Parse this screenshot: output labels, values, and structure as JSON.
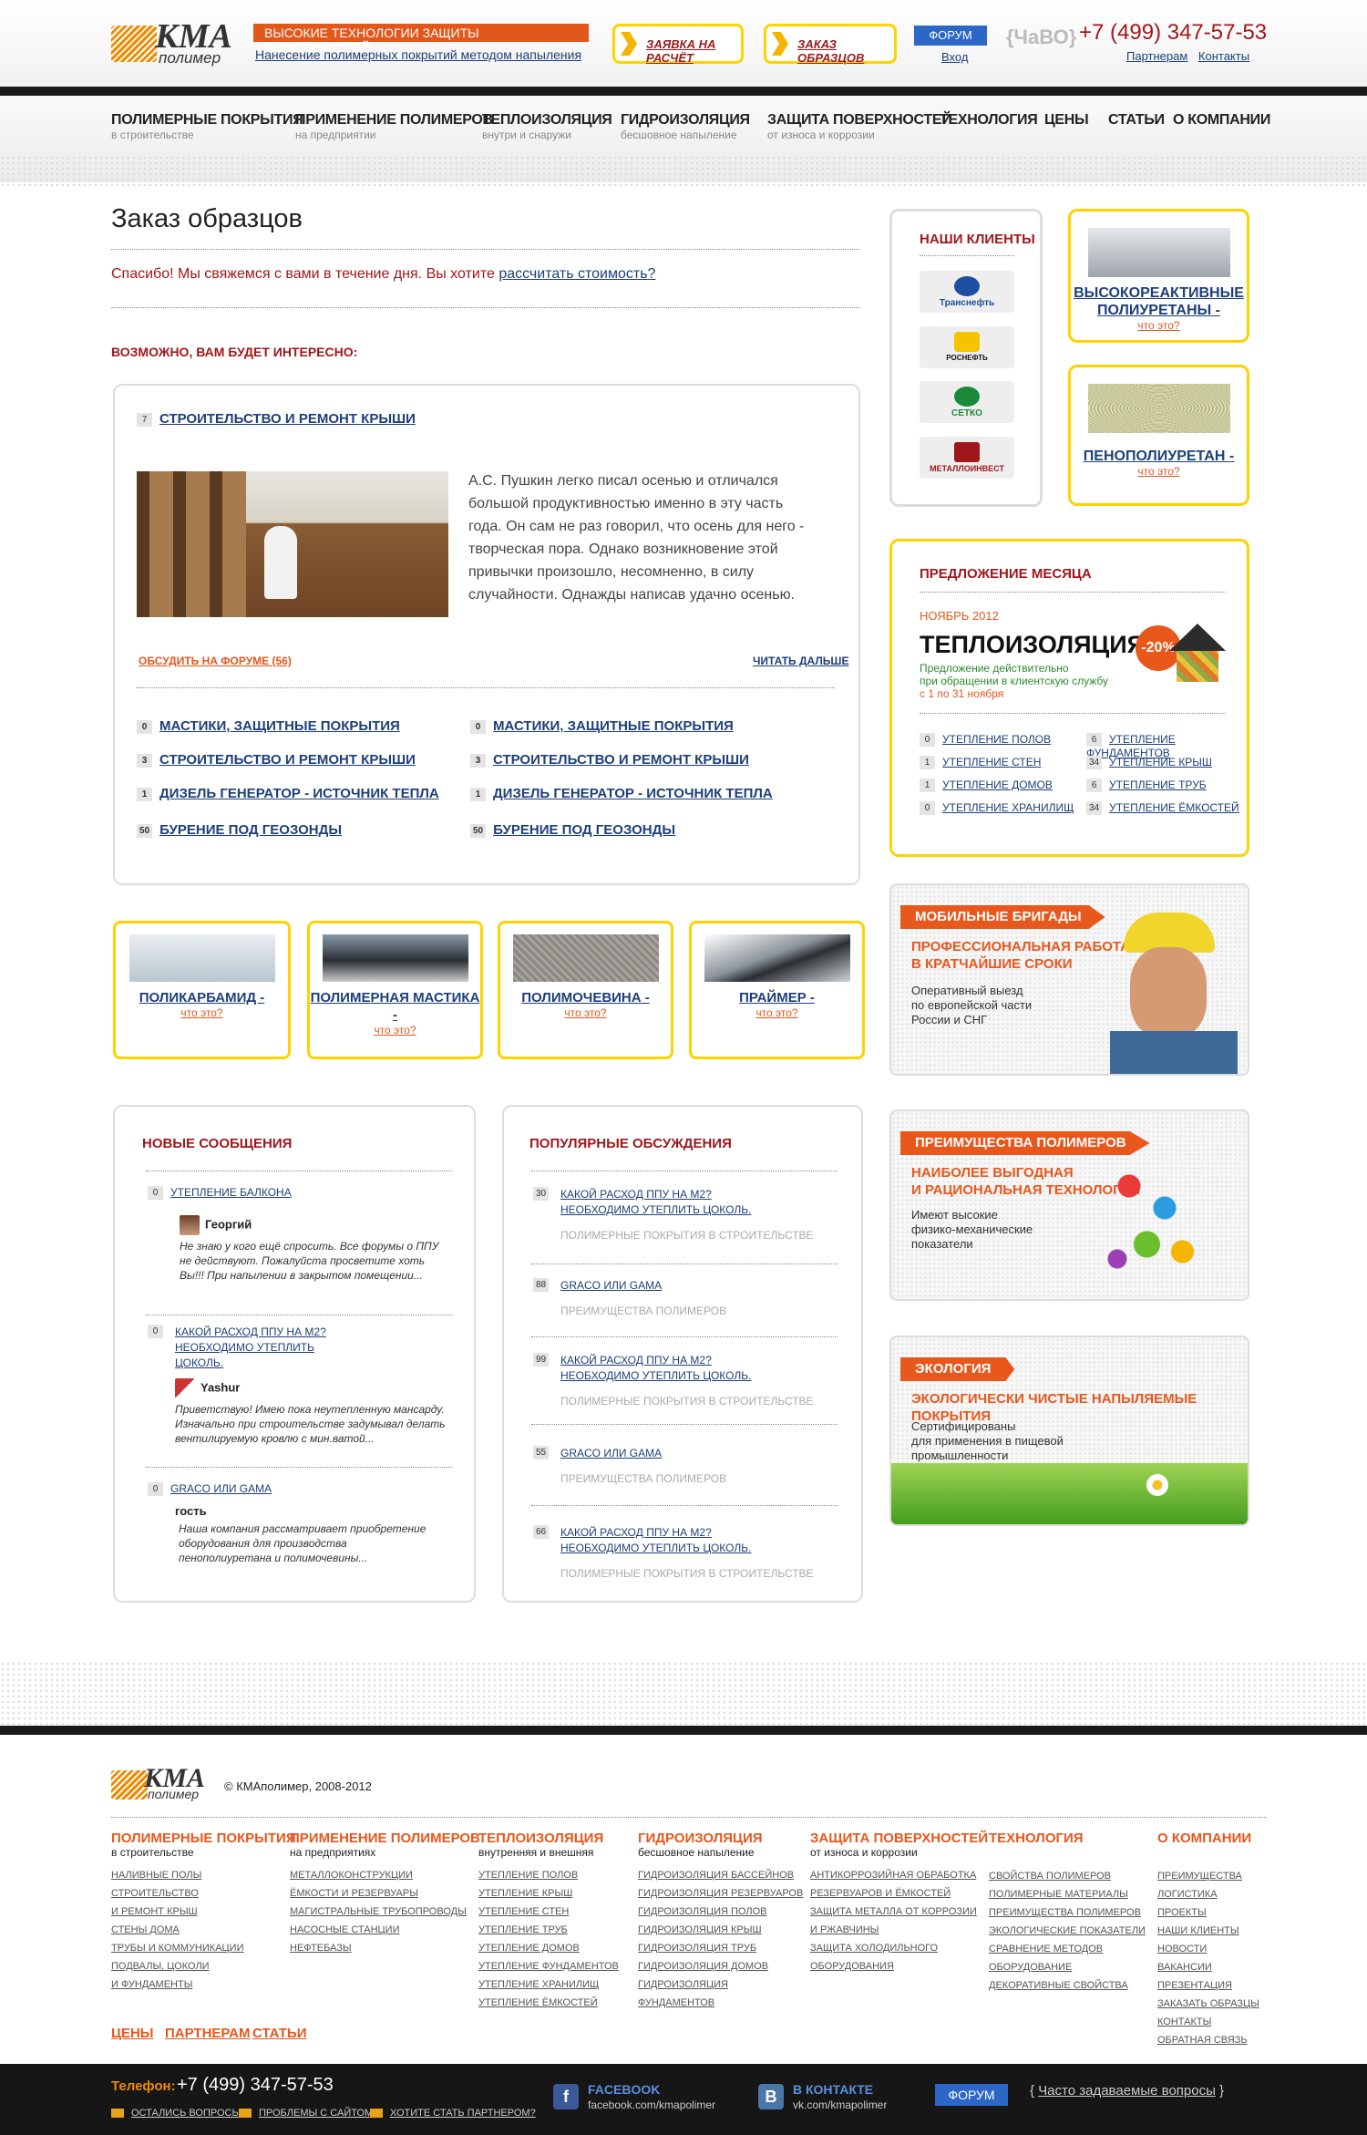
{
  "header": {
    "logo_main": "КМА",
    "logo_sub": "полимер",
    "tagline": "ВЫСОКИЕ ТЕХНОЛОГИИ ЗАЩИТЫ ПОВЕРХНОСТЕЙ",
    "tagline_link": "Нанесение полимерных покрытий методом напыления",
    "btn_request": "Заявка на расчёт",
    "btn_samples": "Заказ образцов",
    "forum": "ФОРУМ",
    "login": "Вход",
    "faq_logo": "{ЧаВО}",
    "phone": "+7 (499) 347-57-53",
    "partners": "Партнерам",
    "contacts": "Контакты"
  },
  "nav": [
    {
      "main": "Полимерные покрытия",
      "sub": "в строительстве"
    },
    {
      "main": "Применение полимеров",
      "sub": "на предприятии"
    },
    {
      "main": "Теплоизоляция",
      "sub": "внутри и снаружи"
    },
    {
      "main": "Гидроизоляция",
      "sub": "бесшовное напыление"
    },
    {
      "main": "Защита поверхностей",
      "sub": "от износа и коррозии"
    },
    {
      "main": "Технология",
      "sub": ""
    },
    {
      "main": "Цены",
      "sub": ""
    },
    {
      "main": "Статьи",
      "sub": ""
    },
    {
      "main": "О компании",
      "sub": ""
    }
  ],
  "content": {
    "title": "Заказ образцов",
    "thanks": "Спасибо! Мы свяжемся с вами в течение дня. Вы хотите",
    "thanks_link": "рассчитать стоимость?",
    "maybe": "Возможно, вам будет интересно:",
    "article": {
      "count": "7",
      "title": "Строительство и ремонт крыши",
      "text": "А.С. Пушкин легко писал осенью и отличался большой продуктивностью именно в эту часть года. Он сам не раз говорил, что осень для него - творческая пора. Однако возникновение этой привычки произошло, несомненно, в силу случайности. Однажды написав удачно осенью.",
      "discuss": "Обсудить на форуме (56)",
      "read_more": "Читать дальше"
    },
    "links_left": [
      {
        "n": "0",
        "t": "Мастики, защитные покрытия"
      },
      {
        "n": "3",
        "t": "Строительство и ремонт крыши"
      },
      {
        "n": "1",
        "t": "Дизель генератор - источник тепла"
      },
      {
        "n": "50",
        "t": "Бурение под геозонды"
      }
    ],
    "links_right": [
      {
        "n": "0",
        "t": "Мастики, защитные покрытия"
      },
      {
        "n": "3",
        "t": "Строительство и ремонт крыши"
      },
      {
        "n": "1",
        "t": "Дизель генератор - источник тепла"
      },
      {
        "n": "50",
        "t": "Бурение под геозонды"
      }
    ],
    "products": [
      {
        "name": "Поликарбамид -",
        "q": "что это?"
      },
      {
        "name": "Полимерная мастика -",
        "q": "что это?"
      },
      {
        "name": "Полимочевина -",
        "q": "что это?"
      },
      {
        "name": "Праймер -",
        "q": "что это?"
      }
    ]
  },
  "new_messages": {
    "title": "Новые сообщения",
    "items": [
      {
        "n": "0",
        "t": "Утепление балкона",
        "author": "Георгий",
        "msg": "Не знаю у кого ещё спросить. Все форумы о ППУ не действуют. Пожалуйста просветите хоть Вы!!! При напылении в закрытом помещении..."
      },
      {
        "n": "0",
        "t": "Какой расход ППУ на м2? Необходимо утеплить цоколь.",
        "author": "Yashur",
        "msg": "Приветствую! Имею пока неутепленную мансарду. Изначально при строительстве задумывал делать вентилируемую кровлю с мин.ватой..."
      },
      {
        "n": "0",
        "t": "GRACO или GAMA",
        "author": "гость",
        "msg": "Наша компания рассматривает приобретение оборудования для производства пенополиуретана и полимочевины..."
      }
    ]
  },
  "popular": {
    "title": "Популярные обсуждения",
    "items": [
      {
        "n": "30",
        "t": "Какой расход ППУ на м2? Необходимо утеплить цоколь.",
        "cat": "Полимерные покрытия в строительстве"
      },
      {
        "n": "88",
        "t": "GRACO или GAMA",
        "cat": "Преимущества полимеров"
      },
      {
        "n": "99",
        "t": "Какой расход ППУ на м2? Необходимо утеплить цоколь.",
        "cat": "Полимерные покрытия в строительстве"
      },
      {
        "n": "55",
        "t": "GRACO или GAMA",
        "cat": "Преимущества полимеров"
      },
      {
        "n": "66",
        "t": "Какой расход ППУ на м2? Необходимо утеплить цоколь.",
        "cat": "Полимерные покрытия в строительстве"
      }
    ]
  },
  "sidebar": {
    "clients_title": "Наши клиенты",
    "clients": [
      "Транснефть",
      "РОСНЕФТЬ",
      "СЕТКО",
      "МЕТАЛЛОИНВЕСТ"
    ],
    "box1": {
      "name": "Высокореактивные полиуретаны -",
      "q": "что это?"
    },
    "box2": {
      "name": "Пенополиуретан -",
      "q": "что это?"
    },
    "offer": {
      "title": "Предложение месяца",
      "month": "Ноябрь 2012",
      "big": "Теплоизоляция",
      "discount": "-20%",
      "desc1": "Предложение действительно",
      "desc2": "при обращении в клиентскую службу",
      "desc3": "с 1 по 31 ноября",
      "rows_left": [
        {
          "n": "0",
          "t": "Утепление полов"
        },
        {
          "n": "1",
          "t": "Утепление стен"
        },
        {
          "n": "1",
          "t": "Утепление домов"
        },
        {
          "n": "0",
          "t": "Утепление хранилищ"
        }
      ],
      "rows_right": [
        {
          "n": "6",
          "t": "Утепление фундаментов"
        },
        {
          "n": "34",
          "t": "Утепление крыш"
        },
        {
          "n": "6",
          "t": "Утепление труб"
        },
        {
          "n": "34",
          "t": "Утепление ёмкостей"
        }
      ]
    },
    "banner1": {
      "tab": "Мобильные бригады",
      "sub1": "Профессиональная работа",
      "sub2": "в кратчайшие сроки",
      "t1": "Оперативный выезд",
      "t2": "по европейской части",
      "t3": "России и СНГ"
    },
    "banner2": {
      "tab": "Преимущества полимеров",
      "sub1": "Наиболее выгодная",
      "sub2": "и рациональная технология",
      "t1": "Имеют высокие",
      "t2": "физико-механические",
      "t3": "показатели"
    },
    "banner3": {
      "tab": "Экология",
      "sub1": "Экологически чистые напыляемые покрытия",
      "t1": "Сертифицированы",
      "t2": "для применения в пищевой",
      "t3": "промышленности"
    }
  },
  "footer": {
    "copyright": "© КМАполимер, 2008-2012",
    "cols": [
      {
        "m": "Полимерные покрытия",
        "s": "в строительстве",
        "items": [
          "Наливные полы",
          "Строительство",
          "и ремонт крыш",
          "Стены дома",
          "Трубы и коммуникации",
          "Подвалы, цоколи",
          "и фундаменты"
        ]
      },
      {
        "m": "Применение полимеров",
        "s": "на предприятиях",
        "items": [
          "Металлоконструкции",
          "Ёмкости и резервуары",
          "Магистральные трубопроводы",
          "Насосные станции",
          "Нефтебазы"
        ]
      },
      {
        "m": "Теплоизоляция",
        "s": "внутренняя и внешняя",
        "items": [
          "Утепление полов",
          "Утепление крыш",
          "Утепление стен",
          "Утепление труб",
          "Утепление домов",
          "Утепление фундаментов",
          "Утепление хранилищ",
          "Утепление ёмкостей"
        ]
      },
      {
        "m": "Гидроизоляция",
        "s": "бесшовное напыление",
        "items": [
          "Гидроизоляция бассейнов",
          "Гидроизоляция резервуаров",
          "Гидроизоляция полов",
          "Гидроизоляция крыш",
          "Гидроизоляция труб",
          "Гидроизоляция домов",
          "Гидроизоляция",
          "фундаментов"
        ]
      },
      {
        "m": "Защита поверхностей",
        "s": "от износа и коррозии",
        "items": [
          "Антикоррозийная обработка",
          "резервуаров и ёмкостей",
          "Защита металла от коррозии",
          "и ржавчины",
          "Защита холодильного",
          "оборудования"
        ]
      },
      {
        "m": "Технология",
        "s": "",
        "items": [
          "Свойства полимеров",
          "Полимерные материалы",
          "Преимущества полимеров",
          "Экологические показатели",
          "Сравнение методов",
          "Оборудование",
          "Декоративные свойства"
        ]
      },
      {
        "m": "О компании",
        "s": "",
        "items": [
          "Преимущества",
          "Логистика",
          "Проекты",
          "Наши клиенты",
          "Новости",
          "Вакансии",
          "Презентация",
          "Заказать образцы",
          "Контакты",
          "Обратная связь"
        ]
      }
    ],
    "bottom_links": [
      "Цены",
      "Партнерам",
      "Статьи"
    ],
    "phone_label": "Телефон:",
    "phone": "+7 (499) 347-57-53",
    "q1": "Остались вопросы?",
    "q2": "Проблемы с сайтом?",
    "q3": "Хотите стать партнером?",
    "fb_name": "Facebook",
    "fb_url": "facebook.com/kmapolimer",
    "vk_name": "В контакте",
    "vk_url": "vk.com/kmapolimer",
    "forum": "Форум",
    "faq": "Часто задаваемые вопросы"
  },
  "colors": {
    "brand_orange": "#e8571c",
    "brand_red": "#a0171b",
    "link_blue": "#1d3f7a",
    "accent_yellow": "#ffd200"
  }
}
